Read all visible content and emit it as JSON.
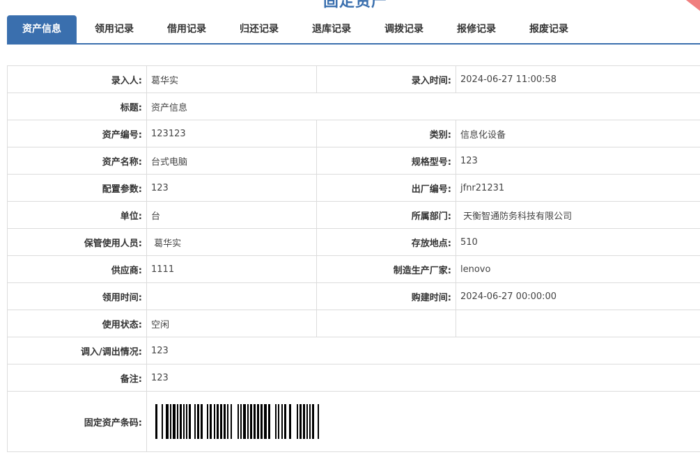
{
  "header": {
    "title": "固定资产"
  },
  "tabs": [
    {
      "label": "资产信息",
      "active": true
    },
    {
      "label": "领用记录",
      "active": false
    },
    {
      "label": "借用记录",
      "active": false
    },
    {
      "label": "归还记录",
      "active": false
    },
    {
      "label": "退库记录",
      "active": false
    },
    {
      "label": "调拨记录",
      "active": false
    },
    {
      "label": "报修记录",
      "active": false
    },
    {
      "label": "报废记录",
      "active": false
    }
  ],
  "details": {
    "entry_person": {
      "label": "录入人:",
      "value": "葛华实"
    },
    "entry_time": {
      "label": "录入时间:",
      "value": "2024-06-27 11:00:58"
    },
    "title": {
      "label": "标题:",
      "value": "资产信息"
    },
    "asset_no": {
      "label": "资产编号:",
      "value": "123123"
    },
    "category": {
      "label": "类别:",
      "value": "信息化设备"
    },
    "asset_name": {
      "label": "资产名称:",
      "value": "台式电脑"
    },
    "model": {
      "label": "规格型号:",
      "value": "123"
    },
    "config": {
      "label": "配置参数:",
      "value": "123"
    },
    "factory_no": {
      "label": "出厂编号:",
      "value": "jfnr21231"
    },
    "unit": {
      "label": "单位:",
      "value": "台"
    },
    "department": {
      "label": "所属部门:",
      "value": " 天衡智通防务科技有限公司"
    },
    "custodian": {
      "label": "保管使用人员:",
      "value": " 葛华实"
    },
    "location": {
      "label": "存放地点:",
      "value": "510"
    },
    "supplier": {
      "label": "供应商:",
      "value": "1111"
    },
    "manufacturer": {
      "label": "制造生产厂家:",
      "value": "lenovo"
    },
    "receive_time": {
      "label": "领用时间:",
      "value": ""
    },
    "purchase_time": {
      "label": "购建时间:",
      "value": "2024-06-27 00:00:00"
    },
    "status": {
      "label": "使用状态:",
      "value": "空闲"
    },
    "transfer": {
      "label": "调入/调出情况:",
      "value": "123"
    },
    "remark": {
      "label": "备注:",
      "value": "123"
    },
    "barcode": {
      "label": "固定资产条码:"
    }
  },
  "colors": {
    "accent": "#3a6fae",
    "ribbon": "#f07f7f",
    "border": "#dcdcdc"
  }
}
